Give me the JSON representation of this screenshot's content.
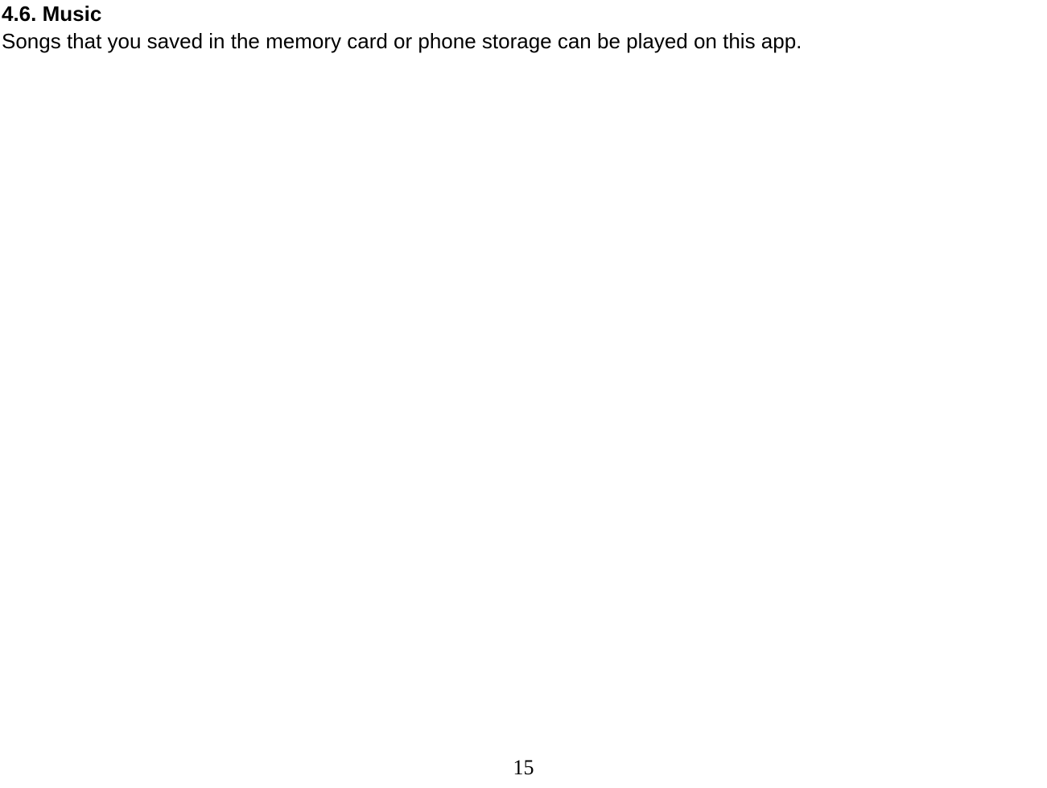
{
  "section": {
    "heading": "4.6. Music",
    "body": "Songs that you saved in the memory card or phone storage can be played on this app."
  },
  "page_number": "15"
}
